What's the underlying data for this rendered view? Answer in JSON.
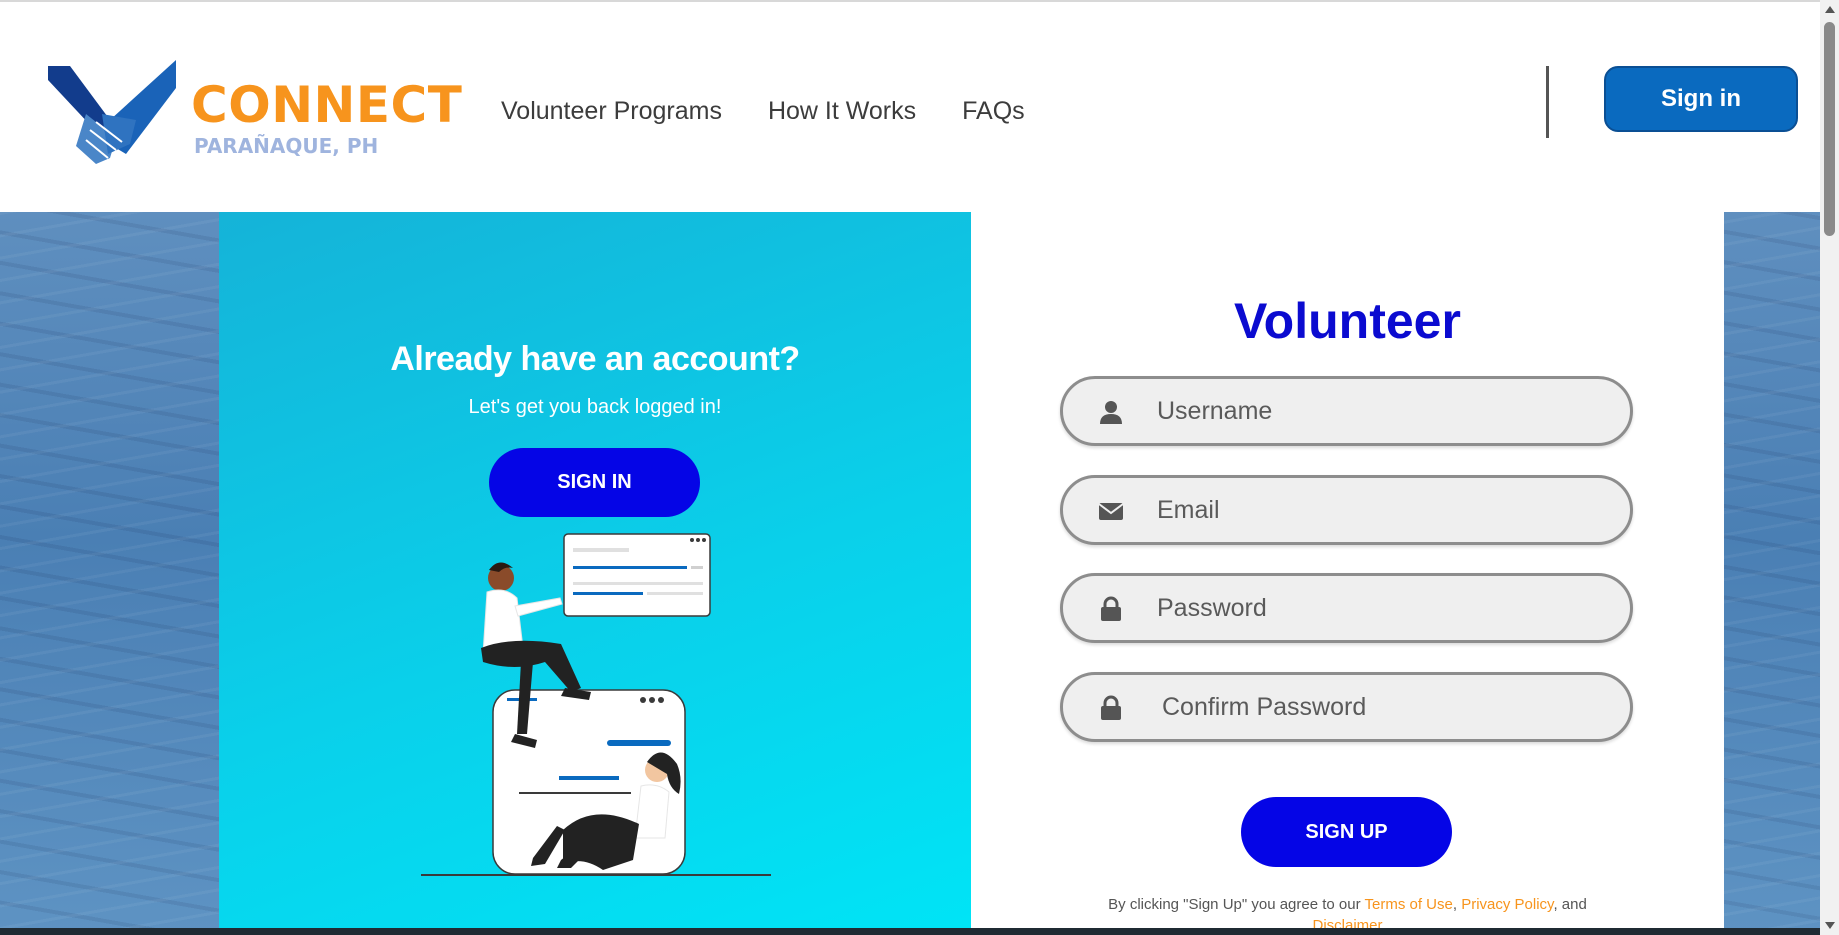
{
  "brand": {
    "name": "CONNECT",
    "location": "PARAÑAQUE, PH"
  },
  "nav": {
    "items": [
      "Volunteer Programs",
      "How It Works",
      "FAQs"
    ]
  },
  "header": {
    "signin_label": "Sign in"
  },
  "left_panel": {
    "title": "Already have an account?",
    "subtitle": "Let's get you back logged in!",
    "button_label": "SIGN IN"
  },
  "form": {
    "title": "Volunteer",
    "fields": [
      {
        "placeholder": "Username",
        "icon": "user-icon"
      },
      {
        "placeholder": "Email",
        "icon": "envelope-icon"
      },
      {
        "placeholder": "Password",
        "icon": "lock-icon"
      },
      {
        "placeholder": "Confirm Password",
        "icon": "lock-icon"
      }
    ],
    "submit_label": "SIGN UP",
    "terms_prefix": "By clicking \"Sign Up\" you agree to our ",
    "terms_link": "Terms of Use",
    "terms_sep": ", ",
    "privacy_link": "Privacy Policy",
    "terms_and": ", and",
    "disclaimer_link": "Disclaimer"
  },
  "colors": {
    "brand_orange": "#f7941d",
    "brand_blue": "#0a6abf",
    "primary_button": "#0505e6",
    "panel_gradient_start": "#15b3d8",
    "panel_gradient_end": "#00e4f6"
  }
}
